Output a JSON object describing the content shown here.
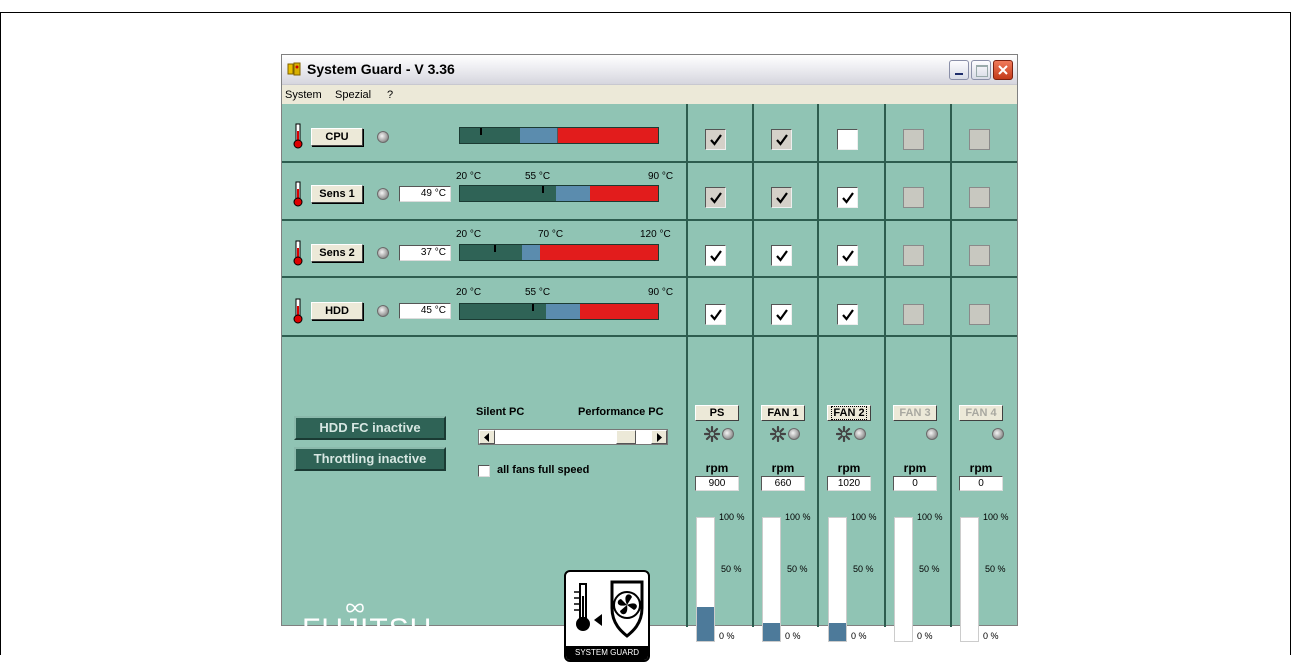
{
  "window": {
    "title": "System Guard - V 3.36"
  },
  "menu": [
    "System",
    "Spezial",
    "?"
  ],
  "sensors": [
    {
      "label": "CPU",
      "value": "",
      "scale": [
        "",
        "",
        ""
      ],
      "marker_pct": 0.1,
      "green_pct": 0.3,
      "blue_pct": 0.2
    },
    {
      "label": "Sens 1",
      "value": "49 °C",
      "scale": [
        "20 °C",
        "55 °C",
        "90 °C"
      ],
      "marker_pct": 0.41,
      "green_pct": 0.47,
      "blue_pct": 0.17
    },
    {
      "label": "Sens 2",
      "value": "37 °C",
      "scale": [
        "20 °C",
        "70 °C",
        "120 °C"
      ],
      "marker_pct": 0.17,
      "green_pct": 0.31,
      "blue_pct": 0.09
    },
    {
      "label": "HDD",
      "value": "45 °C",
      "scale": [
        "20 °C",
        "55 °C",
        "90 °C"
      ],
      "marker_pct": 0.36,
      "green_pct": 0.43,
      "blue_pct": 0.17
    }
  ],
  "checkboxes": [
    [
      "checked-grey",
      "checked-grey",
      "unchecked",
      "disabled",
      "disabled"
    ],
    [
      "checked-grey",
      "checked-grey",
      "checked",
      "disabled",
      "disabled"
    ],
    [
      "checked",
      "checked",
      "checked",
      "disabled",
      "disabled"
    ],
    [
      "checked",
      "checked",
      "checked",
      "disabled",
      "disabled"
    ]
  ],
  "controls": {
    "hdd_fc": "HDD FC inactive",
    "throttling": "Throttling inactive",
    "silent_label": "Silent PC",
    "performance_label": "Performance PC",
    "all_fans_label": "all fans full speed"
  },
  "fans": [
    {
      "label": "PS",
      "rpm_label": "rpm",
      "rpm": "900",
      "fill_pct": 28,
      "enabled": true,
      "spinner": true
    },
    {
      "label": "FAN 1",
      "rpm_label": "rpm",
      "rpm": "660",
      "fill_pct": 15,
      "enabled": true,
      "spinner": true
    },
    {
      "label": "FAN 2",
      "rpm_label": "rpm",
      "rpm": "1020",
      "fill_pct": 15,
      "enabled": true,
      "spinner": true,
      "focused": true
    },
    {
      "label": "FAN 3",
      "rpm_label": "rpm",
      "rpm": "0",
      "fill_pct": 0,
      "enabled": false,
      "spinner": false
    },
    {
      "label": "FAN 4",
      "rpm_label": "rpm",
      "rpm": "0",
      "fill_pct": 0,
      "enabled": false,
      "spinner": false
    }
  ],
  "fan_scale": [
    "100 %",
    "50 %",
    "0 %"
  ],
  "logos": {
    "fujitsu": "FUJITSU",
    "system_guard": "SYSTEM GUARD"
  },
  "colors": {
    "panel": "#90c4b4",
    "grid": "#2d5d4f",
    "bar_green": "#2f6356",
    "bar_blue": "#5b8cae",
    "bar_red": "#e21c1c",
    "fan_fill": "#4d7a9a"
  }
}
